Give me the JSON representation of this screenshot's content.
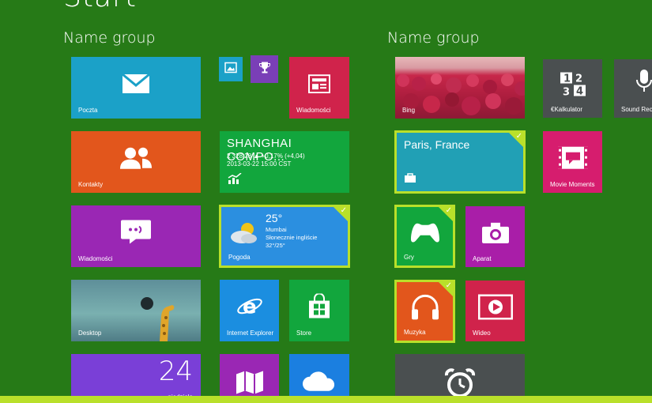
{
  "page": {
    "title": "Start"
  },
  "groups": [
    {
      "title": "Name group"
    },
    {
      "title": "Name group"
    }
  ],
  "tiles": {
    "mail": {
      "label": "Poczta",
      "icon": "mail-icon",
      "color": "#1ba1c8"
    },
    "photos": {
      "icon": "photos-icon",
      "color": "#1ba1c8"
    },
    "games": {
      "icon": "trophy-icon",
      "color": "#7a3fb7"
    },
    "news": {
      "label": "Wiadomości",
      "icon": "news-icon",
      "color": "#d0234b"
    },
    "contacts": {
      "label": "Kontakty",
      "icon": "people-icon",
      "color": "#e2561c"
    },
    "finance": {
      "name": "SHANGHAI COMPO...",
      "line1": "2 328,28 ▲ +0,17% (+4,04)",
      "line2": "2013-03-22 15:00 CST",
      "icon": "stock-chart-icon",
      "color": "#12a63d"
    },
    "messaging": {
      "label": "Wiadomości",
      "icon": "chat-icon",
      "color": "#9a27b4"
    },
    "weather": {
      "label": "Pogoda",
      "temp": "25°",
      "city": "Mumbai",
      "condition": "Słonecznie ingliście",
      "range": "32°/25°",
      "icon": "partly-cloudy-icon",
      "color": "#2b8fe0"
    },
    "desktop": {
      "label": "Desktop",
      "color": "#6ea1a8"
    },
    "ie": {
      "label": "Internet Explorer",
      "icon": "internet-explorer-icon",
      "color": "#1b8ee0"
    },
    "store": {
      "label": "Store",
      "icon": "store-bag-icon",
      "color": "#12a63d"
    },
    "calendar": {
      "day": "24",
      "weekday": "niedziela",
      "color": "#7a3fd7"
    },
    "maps": {
      "icon": "map-icon",
      "color": "#9a27b4"
    },
    "skydrive": {
      "icon": "cloud-icon",
      "color": "#1b7fe0"
    },
    "bing": {
      "label": "Bing",
      "color": "#c7274a"
    },
    "calculator": {
      "label": "€Kalkulator",
      "icon": "calculator-icon",
      "color": "#4a4f50"
    },
    "recorder": {
      "label": "Sound Reco",
      "icon": "microphone-icon",
      "color": "#4a4f50"
    },
    "travel": {
      "title": "Paris, France",
      "icon": "suitcase-icon",
      "color": "#21a0b5"
    },
    "movie_moments": {
      "label": "Movie Moments",
      "icon": "film-speech-icon",
      "color": "#d61d6e"
    },
    "xbox_games": {
      "label": "Gry",
      "icon": "game-controller-icon",
      "color": "#12a63d"
    },
    "camera": {
      "label": "Aparat",
      "icon": "camera-icon",
      "color": "#a91ea8"
    },
    "music": {
      "label": "Muzyka",
      "icon": "headphones-icon",
      "color": "#e2561c"
    },
    "video": {
      "label": "Wideo",
      "icon": "play-icon",
      "color": "#d0234b"
    },
    "alarms": {
      "icon": "alarm-clock-icon",
      "color": "#4a4f50"
    }
  }
}
